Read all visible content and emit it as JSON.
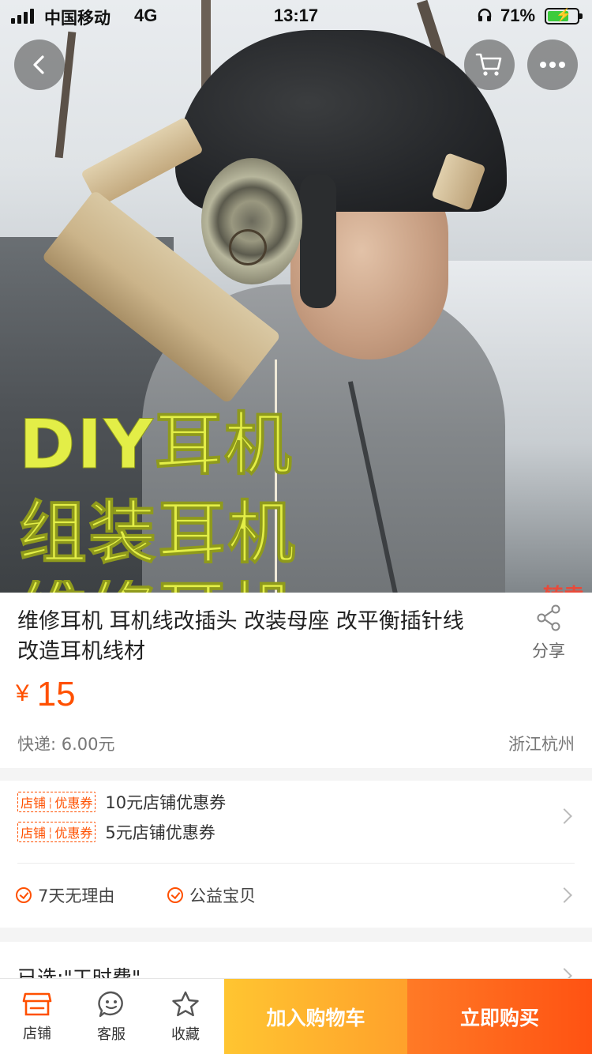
{
  "status_bar": {
    "carrier": "中国移动",
    "network": "4G",
    "time": "13:17",
    "battery_percent": "71%",
    "battery_level": 0.71,
    "icons": [
      "signal-icon",
      "headphone-icon",
      "battery-charging-icon"
    ]
  },
  "nav": {
    "icons": [
      "back-icon",
      "cart-icon",
      "more-icon"
    ]
  },
  "hero": {
    "text_line1": "DIY耳机",
    "text_line2": "组装耳机",
    "text_line3": "维修耳机",
    "watermark": "转卖"
  },
  "product": {
    "title": "维修耳机 耳机线改插头 改装母座  改平衡插针线 改造耳机线材",
    "share_label": "分享",
    "currency": "¥",
    "price": "15",
    "shipping": "快递: 6.00元",
    "location": "浙江杭州"
  },
  "coupons": [
    {
      "tag_left": "店铺",
      "tag_right": "优惠券",
      "text": "10元店铺优惠券"
    },
    {
      "tag_left": "店铺",
      "tag_right": "优惠券",
      "text": "5元店铺优惠券"
    }
  ],
  "services": [
    {
      "label": "7天无理由"
    },
    {
      "label": "公益宝贝"
    }
  ],
  "spec": {
    "selected": "已选:\"工时费\""
  },
  "bottom_bar": {
    "store_label": "店铺",
    "service_label": "客服",
    "favorite_label": "收藏",
    "add_to_cart": "加入购物车",
    "buy_now": "立即购买"
  },
  "colors": {
    "accent": "#ff5000",
    "cart_button": "#ffa12b",
    "buy_button": "#ff5212",
    "hero_text": "#e3ee47"
  }
}
